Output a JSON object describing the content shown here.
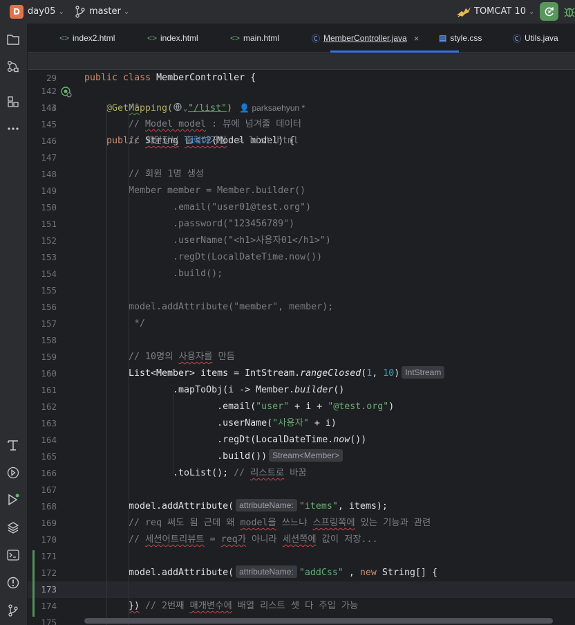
{
  "titlebar": {
    "project_badge": "D",
    "project_name": "day05",
    "branch": "master",
    "run_config": "TOMCAT 10",
    "accent_color": "#e0734a",
    "run_color": "#57965c"
  },
  "tabs": [
    {
      "label": "index2.html",
      "icon": "html-icon"
    },
    {
      "label": "index.html",
      "icon": "html-icon"
    },
    {
      "label": "main.html",
      "icon": "html-icon"
    },
    {
      "label": "MemberController.java",
      "icon": "class-icon",
      "active": true,
      "close": "×"
    },
    {
      "label": "style.css",
      "icon": "css-icon"
    },
    {
      "label": "Utils.java",
      "icon": "class-icon"
    }
  ],
  "toolstrip": [
    "project-icon",
    "structure-icon",
    "plugins-icon",
    "more-icon",
    "build-icon",
    "services-icon",
    "run-icon",
    "layers-icon",
    "terminal-icon",
    "problems-icon",
    "git-icon"
  ],
  "editor": {
    "sticky": {
      "num": "29",
      "parts": [
        "public",
        " class ",
        "MemberController",
        " {"
      ]
    },
    "author": "parksaehyun *",
    "hint_intstream": "IntStream",
    "hint_stream": "Stream<Member>",
    "hint_attribute": "attributeName:",
    "lines": {
      "n142": "142",
      "n143": "143",
      "n144": "144",
      "n145": "145",
      "n146": "146",
      "n147": "147",
      "n148": "148",
      "n149": "149",
      "n150": "150",
      "n151": "151",
      "n152": "152",
      "n153": "153",
      "n154": "154",
      "n155": "155",
      "n156": "156",
      "n157": "157",
      "n158": "158",
      "n159": "159",
      "n160": "160",
      "n161": "161",
      "n162": "162",
      "n163": "163",
      "n164": "164",
      "n165": "165",
      "n166": "166",
      "n167": "167",
      "n168": "168",
      "n169": "169",
      "n170": "170",
      "n171": "171",
      "n172": "172",
      "n173": "173",
      "n174": "174",
      "n175": "175"
    },
    "t142a": "@GetMapping(",
    "t142b": "\"/list\"",
    "t142c": ")",
    "t143a": "public",
    "t143b": " String ",
    "t143c": "list2",
    "t143d": "(Model model) {",
    "t144": "/*",
    "t145a": "// ",
    "t145b": "Model model",
    "t145c": " : 뷰에 넘겨줄 데이터",
    "t146a": "// ",
    "t146b": "회원정보",
    "t146c": " ",
    "t146d": "출력하거임",
    "t146e": " -> list.html",
    "t148": "// 회원 1명 생성",
    "t149": "Member member = Member.builder()",
    "t150": "        .email(\"user01@test.org\")",
    "t151": "        .password(\"123456789\")",
    "t152": "        .userName(\"<h1>사용자01</h1>\")",
    "t153": "        .regDt(LocalDateTime.now())",
    "t154": "        .build();",
    "t156": "model.addAttribute(\"member\", member);",
    "t157": " */",
    "t159a": "// 10명의 ",
    "t159b": "사용자를",
    "t159c": " 만듬",
    "t160a": "List<Member> items = IntStream.",
    "t160b": "rangeClosed",
    "t160c": "(",
    "t160d": "1",
    "t160e": ", ",
    "t160f": "10",
    "t160g": ")",
    "t161a": "        .mapToObj(i -> Member.",
    "t161b": "builder",
    "t161c": "()",
    "t162a": "                .email(",
    "t162b": "\"user\"",
    "t162c": " + i + ",
    "t162d": "\"@test.org\"",
    "t162e": ")",
    "t163a": "                .userName(",
    "t163b": "\"사용자\"",
    "t163c": " + i)",
    "t164a": "                .regDt(LocalDateTime.",
    "t164b": "now",
    "t164c": "())",
    "t165": "                .build())",
    "t166a": "        .toList(); ",
    "t166b": "// ",
    "t166c": "리스트로",
    "t166d": " 바꿈",
    "t168a": "model.addAttribute(",
    "t168b": "\"items\"",
    "t168c": ", items);",
    "t169a": "// req 써도 됨 근데 왜 ",
    "t169b": "model을",
    "t169c": " 쓰느냐 ",
    "t169d": "스프링쪽에",
    "t169e": " 있는 기능과 관련",
    "t170a": "// ",
    "t170b": "세션어트리뷰트",
    "t170c": " = ",
    "t170d": "req가",
    "t170e": " 아니라 ",
    "t170f": "세션쪽에",
    "t170g": " 값이 저장...",
    "t172a": "model.addAttribute(",
    "t172b": "\"addCss\"",
    "t172c": " , ",
    "t172d": "new",
    "t172e": " String[] {",
    "t174a": "})",
    "t174b": " // 2번째 ",
    "t174c": "매개변수에",
    "t174d": " 배열 리스트 셋 다 주입 가능"
  }
}
